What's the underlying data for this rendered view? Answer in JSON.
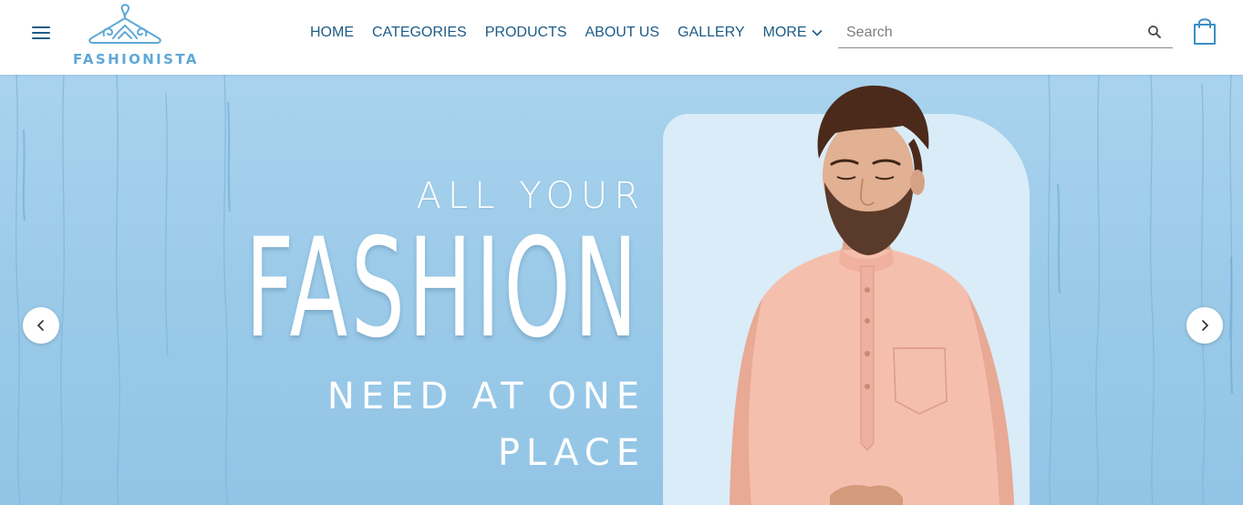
{
  "header": {
    "logo_text": "FASHIONISTA",
    "menu_icon": "hamburger-menu-icon",
    "nav": [
      {
        "label": "HOME"
      },
      {
        "label": "CATEGORIES"
      },
      {
        "label": "PRODUCTS"
      },
      {
        "label": "ABOUT US"
      },
      {
        "label": "GALLERY"
      },
      {
        "label": "MORE",
        "has_dropdown": true
      }
    ],
    "search": {
      "placeholder": "Search",
      "value": "",
      "icon": "search-icon"
    },
    "cart_icon": "shopping-bag-icon"
  },
  "hero": {
    "line1": "ALL YOUR",
    "line2": "FASHION",
    "line3": "NEED AT ONE",
    "line4": "PLACE",
    "prev_icon": "chevron-left-icon",
    "next_icon": "chevron-right-icon"
  },
  "colors": {
    "brand": "#1d5b86",
    "logo": "#5fa8d6",
    "hero_bg": "#9ccbe9",
    "model_card": "#d9ecf8",
    "kurta": "#f5bfae",
    "text_on_hero": "#ffffff"
  }
}
